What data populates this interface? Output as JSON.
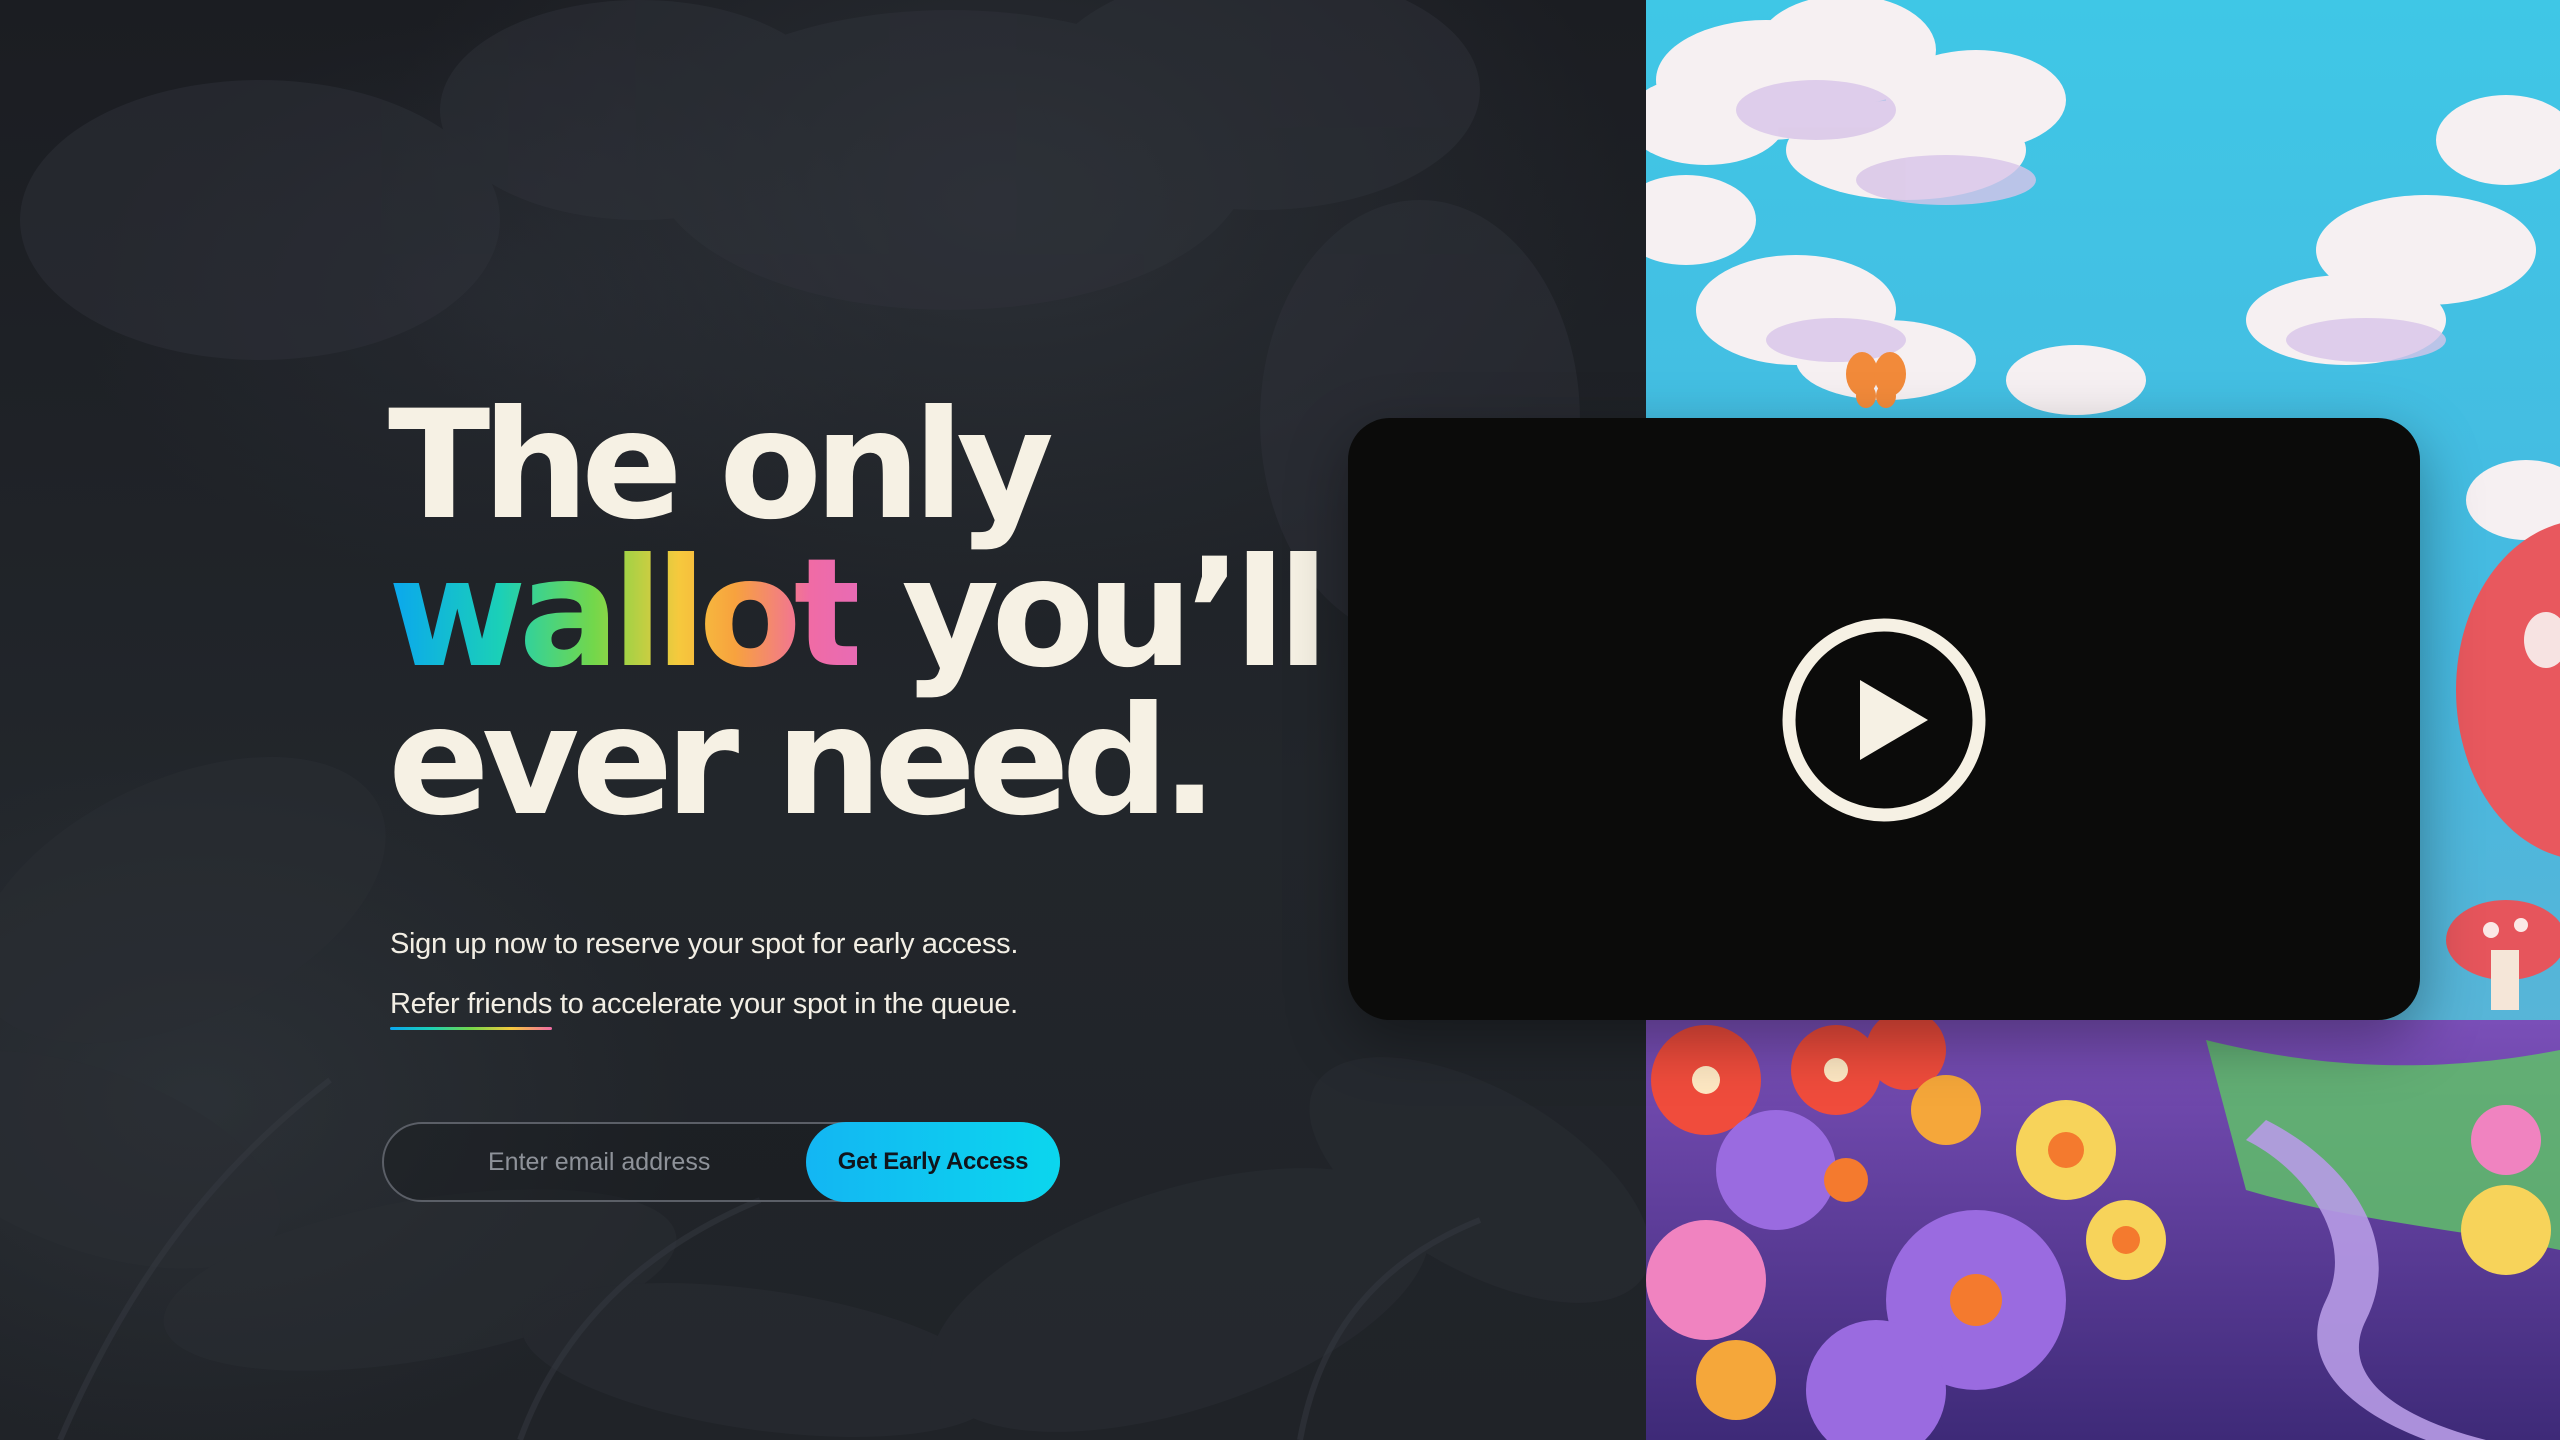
{
  "hero": {
    "headline_line1": "The only",
    "headline_gradient_word": "wallot",
    "headline_line2_rest": " you’ll",
    "headline_line3": "ever need."
  },
  "subtext": {
    "line1": "Sign up now to reserve your spot for early access.",
    "refer_link": "Refer friends",
    "line2_rest": " to accelerate your spot in the queue."
  },
  "signup": {
    "email_placeholder": "Enter email address",
    "email_value": "",
    "button_label": "Get Early Access"
  },
  "video": {
    "play_icon": "play-circle-icon"
  },
  "colors": {
    "background": "#1d1f24",
    "text": "#f6f1e4",
    "cta_start": "#13b6f3",
    "cta_end": "#0bd6ee",
    "video_card": "#0b0b0a",
    "gradient_word": [
      "#0aa6f0",
      "#1bd0b7",
      "#74d74a",
      "#f6c93d",
      "#f06ba5"
    ]
  }
}
